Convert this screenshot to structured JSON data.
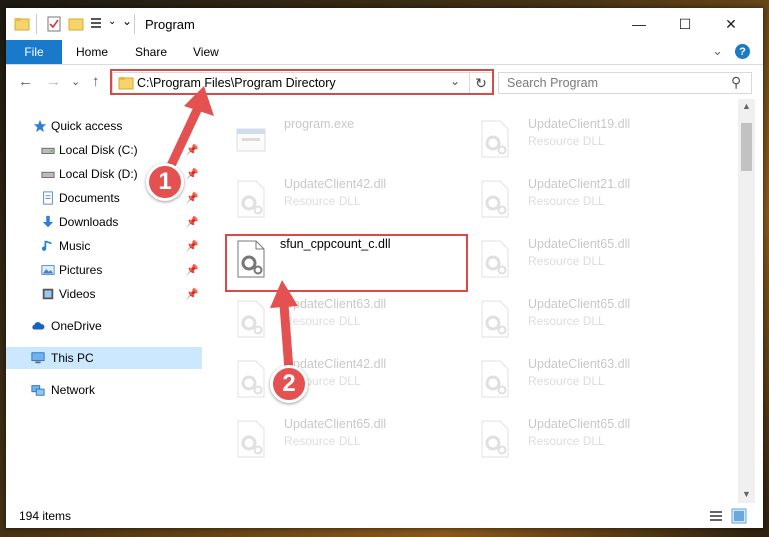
{
  "window": {
    "title": "Program"
  },
  "controls": {
    "minimize": "—",
    "maximize": "☐",
    "close": "✕",
    "expand": "⌄",
    "help": "?"
  },
  "ribbon": {
    "tabs": [
      "File",
      "Home",
      "Share",
      "View"
    ]
  },
  "nav": {
    "back": "←",
    "forward": "→",
    "recent": "⌄",
    "up": "↑"
  },
  "address": {
    "path": "C:\\Program Files\\Program Directory",
    "dropdown": "⌄",
    "refresh": "↻"
  },
  "search": {
    "placeholder": "Search Program",
    "icon": "⚲"
  },
  "sidebar": {
    "items": [
      {
        "label": "Quick access",
        "icon": "star-icon"
      },
      {
        "label": "Local Disk (C:)",
        "icon": "drive-icon"
      },
      {
        "label": "Local Disk (D:)",
        "icon": "drive-icon"
      },
      {
        "label": "Documents",
        "icon": "documents-icon"
      },
      {
        "label": "Downloads",
        "icon": "download-icon"
      },
      {
        "label": "Music",
        "icon": "music-icon"
      },
      {
        "label": "Pictures",
        "icon": "pictures-icon"
      },
      {
        "label": "Videos",
        "icon": "videos-icon"
      },
      {
        "label": "OneDrive",
        "icon": "cloud-icon"
      },
      {
        "label": "This PC",
        "icon": "monitor-icon"
      },
      {
        "label": "Network",
        "icon": "network-icon"
      }
    ],
    "pin": "📌"
  },
  "files": [
    {
      "name": "program.exe",
      "type": ""
    },
    {
      "name": "UpdateClient19.dll",
      "type": "Resource DLL"
    },
    {
      "name": "UpdateClient42.dll",
      "type": "Resource DLL"
    },
    {
      "name": "UpdateClient21.dll",
      "type": "Resource DLL"
    },
    {
      "name": "sfun_cppcount_c.dll",
      "type": ""
    },
    {
      "name": "UpdateClient65.dll",
      "type": "Resource DLL"
    },
    {
      "name": "UpdateClient63.dll",
      "type": "Resource DLL"
    },
    {
      "name": "UpdateClient65.dll",
      "type": "Resource DLL"
    },
    {
      "name": "UpdateClient42.dll",
      "type": "Resource DLL"
    },
    {
      "name": "UpdateClient63.dll",
      "type": "Resource DLL"
    },
    {
      "name": "UpdateClient65.dll",
      "type": "Resource DLL"
    },
    {
      "name": "UpdateClient65.dll",
      "type": "Resource DLL"
    }
  ],
  "status": {
    "count": "194 items"
  },
  "scroll": {
    "up": "▲",
    "down": "▼"
  },
  "callouts": [
    "1",
    "2"
  ],
  "colors": {
    "accent": "#1979ca",
    "highlight": "#d84a4a",
    "selected": "#cce8ff"
  }
}
